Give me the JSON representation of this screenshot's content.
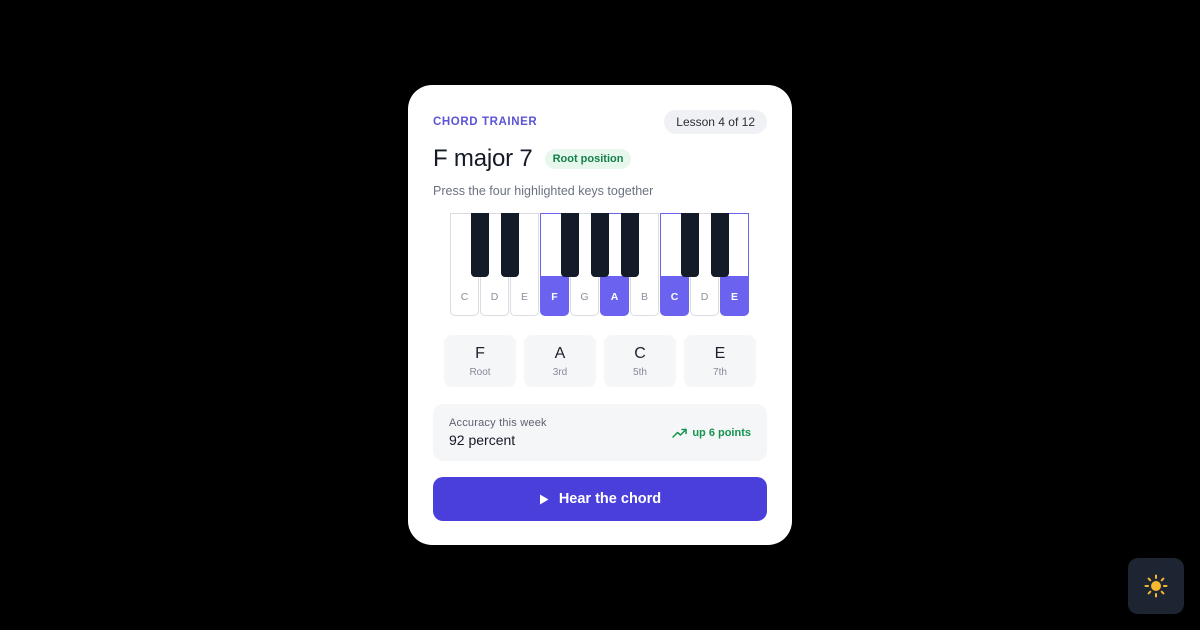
{
  "header": {
    "eyebrow": "CHORD TRAINER",
    "lesson": "Lesson 4 of 12"
  },
  "chord": {
    "title": "F major 7",
    "position_badge": "Root position",
    "instructions": "Press the four highlighted keys together"
  },
  "keyboard": {
    "white_keys": [
      {
        "label": "C",
        "highlighted": false
      },
      {
        "label": "D",
        "highlighted": false
      },
      {
        "label": "E",
        "highlighted": false
      },
      {
        "label": "F",
        "highlighted": true
      },
      {
        "label": "G",
        "highlighted": false
      },
      {
        "label": "A",
        "highlighted": true
      },
      {
        "label": "B",
        "highlighted": false
      },
      {
        "label": "C",
        "highlighted": true
      },
      {
        "label": "D",
        "highlighted": false
      },
      {
        "label": "E",
        "highlighted": true
      }
    ],
    "highlight_color": "#6b63f0"
  },
  "tones": [
    {
      "note": "F",
      "role": "Root"
    },
    {
      "note": "A",
      "role": "3rd"
    },
    {
      "note": "C",
      "role": "5th"
    },
    {
      "note": "E",
      "role": "7th"
    }
  ],
  "accuracy": {
    "label": "Accuracy this week",
    "value": "92 percent",
    "trend": "up 6 points",
    "trend_icon": "trending-up-icon"
  },
  "actions": {
    "play_label": "Hear the chord",
    "play_icon": "play-icon"
  },
  "theme_toggle": {
    "icon": "sun-icon"
  },
  "colors": {
    "accent": "#4a3fdb",
    "eyebrow": "#5b54d6",
    "success": "#15934f"
  }
}
